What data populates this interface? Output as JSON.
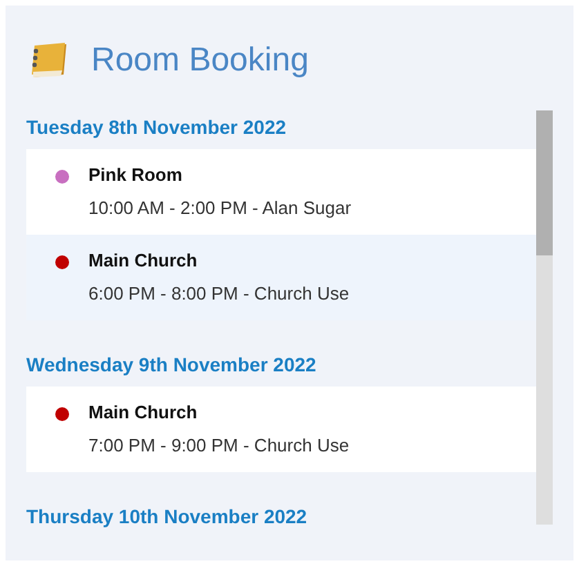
{
  "header": {
    "title": "Room Booking"
  },
  "days": [
    {
      "date": "Tuesday 8th November 2022",
      "bookings": [
        {
          "room": "Pink Room",
          "details": "10:00 AM - 2:00 PM - Alan Sugar",
          "color": "#c86fc0",
          "selected": false
        },
        {
          "room": "Main Church",
          "details": "6:00 PM - 8:00 PM - Church Use",
          "color": "#c00000",
          "selected": true
        }
      ]
    },
    {
      "date": "Wednesday 9th November 2022",
      "bookings": [
        {
          "room": "Main Church",
          "details": "7:00 PM - 9:00 PM - Church Use",
          "color": "#c00000",
          "selected": false
        }
      ]
    },
    {
      "date": "Thursday 10th November 2022"
    }
  ]
}
